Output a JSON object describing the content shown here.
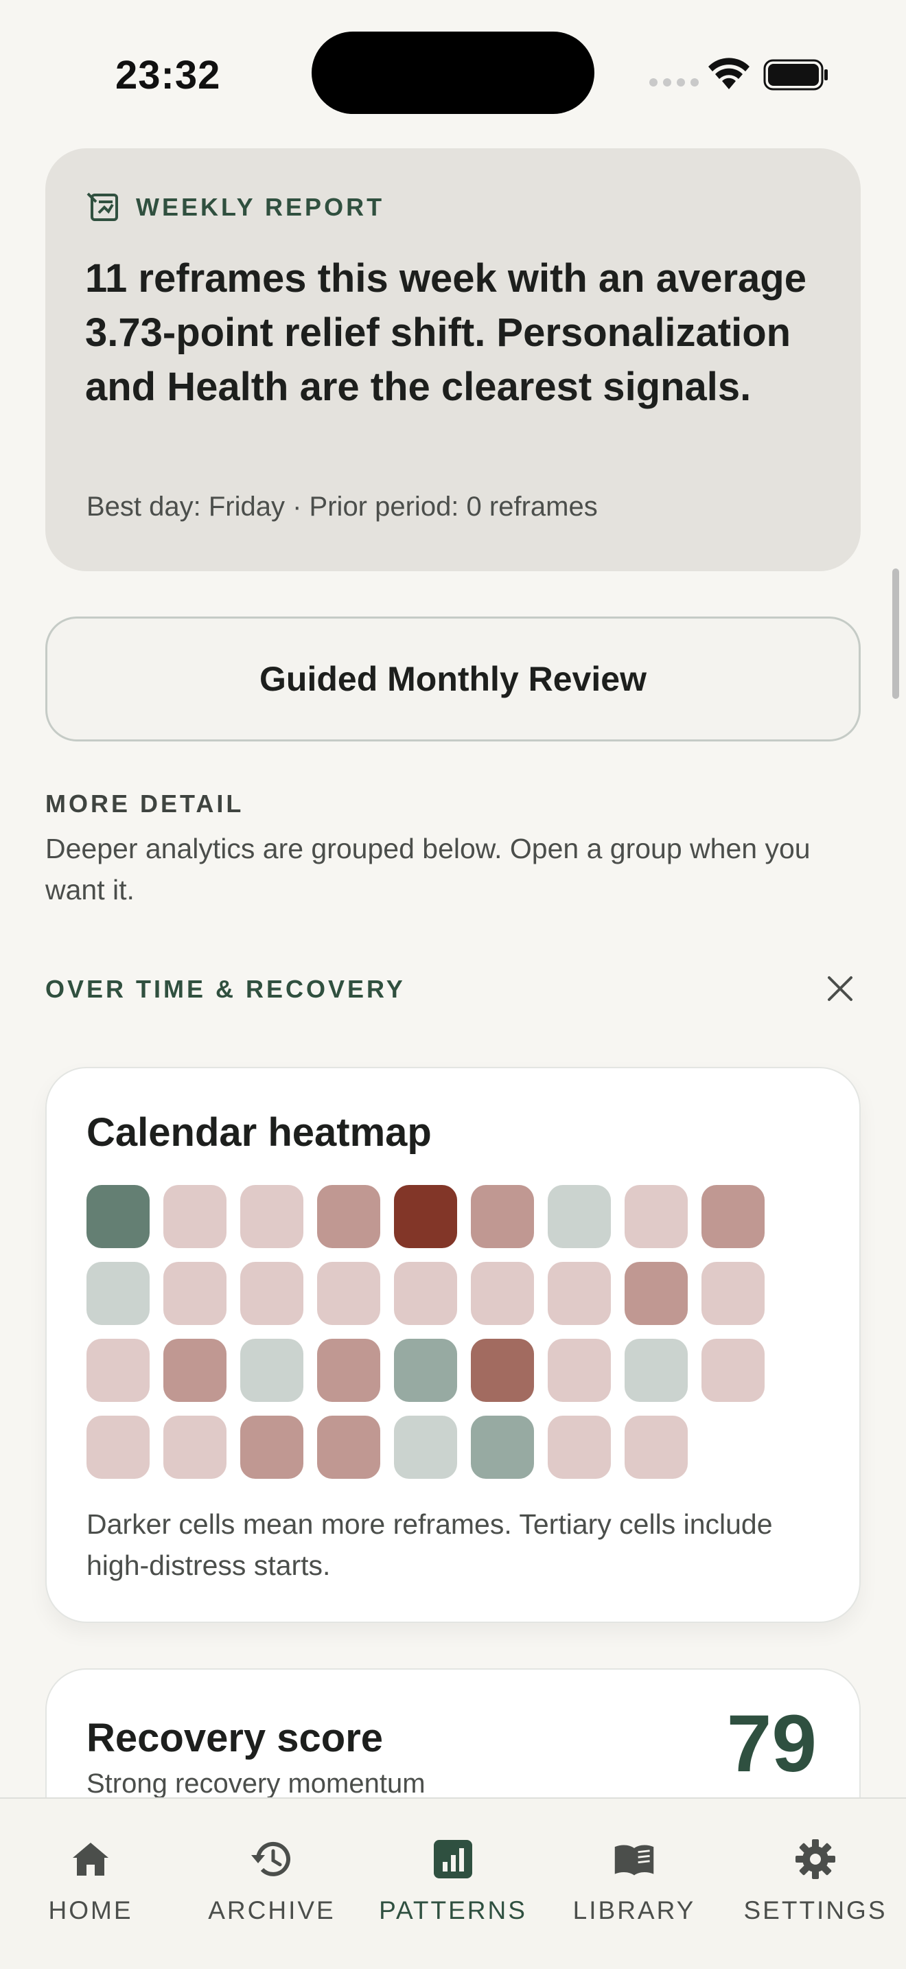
{
  "status_bar": {
    "time": "23:32"
  },
  "weekly_report": {
    "label": "WEEKLY REPORT",
    "body": "11 reframes this week with an average 3.73-point relief shift. Personalization and Health are the clearest signals.",
    "footer": "Best day: Friday · Prior period: 0 reframes"
  },
  "guided_review": {
    "label": "Guided Monthly Review"
  },
  "more_detail": {
    "title": "MORE DETAIL",
    "description": "Deeper analytics are grouped below. Open a group when you want it."
  },
  "section": {
    "title": "OVER TIME & RECOVERY"
  },
  "heatmap": {
    "title": "Calendar heatmap",
    "footer": "Darker cells mean more reframes. Tertiary cells include high-distress starts.",
    "cells": [
      "#647f73",
      "#e0cac8",
      "#e0cac8",
      "#c09892",
      "#823628",
      "#c09892",
      "#cbd3cf",
      "#e0cac8",
      "#c09892",
      "#cbd3cf",
      "#e0cac8",
      "#e0cac8",
      "#e0cac8",
      "#e0cac8",
      "#e0cac8",
      "#e0cac8",
      "#c09892",
      "#e0cac8",
      "#e0cac8",
      "#c09892",
      "#cbd3cf",
      "#c09892",
      "#97aaa2",
      "#a26b60",
      "#e0cac8",
      "#cbd3cf",
      "#e0cac8",
      "#e0cac8",
      "#e0cac8",
      "#c09892",
      "#c09892",
      "#cbd3cf",
      "#97aaa2",
      "#e0cac8",
      "#e0cac8"
    ]
  },
  "recovery": {
    "title": "Recovery score",
    "subtitle": "Strong recovery momentum",
    "score": "79"
  },
  "tabs": [
    {
      "label": "HOME",
      "icon": "home-icon",
      "active": false
    },
    {
      "label": "ARCHIVE",
      "icon": "history-icon",
      "active": false
    },
    {
      "label": "PATTERNS",
      "icon": "chart-icon",
      "active": true
    },
    {
      "label": "LIBRARY",
      "icon": "book-icon",
      "active": false
    },
    {
      "label": "SETTINGS",
      "icon": "gear-icon",
      "active": false
    }
  ],
  "colors": {
    "accent": "#2f5040",
    "background": "#f7f6f2",
    "card_muted": "#e4e2dd"
  }
}
